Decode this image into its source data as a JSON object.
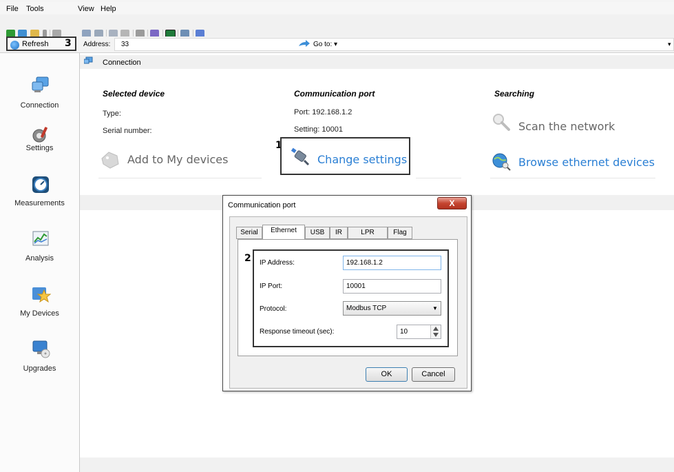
{
  "menu": {
    "file": "File",
    "tools": "Tools",
    "view": "View",
    "help": "Help"
  },
  "toolbar": {
    "refresh_label": "Refresh",
    "address_label": "Address:",
    "address_value": "33",
    "goto_label": "Go to: ▾"
  },
  "annotations": {
    "one": "1",
    "two": "2",
    "three": "3"
  },
  "sidebar": {
    "items": [
      {
        "label": "Connection",
        "icon": "computer-network-icon"
      },
      {
        "label": "Settings",
        "icon": "gears-wrench-icon"
      },
      {
        "label": "Measurements",
        "icon": "gauge-icon"
      },
      {
        "label": "Analysis",
        "icon": "chart-icon"
      },
      {
        "label": "My Devices",
        "icon": "star-folder-icon"
      },
      {
        "label": "Upgrades",
        "icon": "monitor-disc-icon"
      }
    ]
  },
  "breadcrumb": {
    "label": "Connection"
  },
  "main": {
    "selected_device": {
      "heading": "Selected device",
      "type_label": "Type:",
      "serial_label": "Serial number:",
      "add_link": "Add to My devices"
    },
    "communication_port": {
      "heading": "Communication port",
      "port_text": "Port: 192.168.1.2",
      "setting_text": "Setting: 10001",
      "change_link": "Change settings"
    },
    "searching": {
      "heading": "Searching",
      "scan_link": "Scan the network",
      "browse_link": "Browse ethernet devices"
    }
  },
  "dialog": {
    "title": "Communication port",
    "close_label": "X",
    "tabs": [
      "Serial",
      "Ethernet",
      "USB",
      "IR",
      "LPR",
      "Flag"
    ],
    "active_tab": "Ethernet",
    "fields": {
      "ip_address_label": "IP Address:",
      "ip_address_value": "192.168.1.2",
      "ip_port_label": "IP Port:",
      "ip_port_value": "10001",
      "protocol_label": "Protocol:",
      "protocol_value": "Modbus TCP",
      "timeout_label": "Response timeout (sec):",
      "timeout_value": "10"
    },
    "ok_label": "OK",
    "cancel_label": "Cancel"
  },
  "colors": {
    "link_blue": "#2a7fd4",
    "disabled_gray": "#666666",
    "annotation_border": "#333333"
  }
}
